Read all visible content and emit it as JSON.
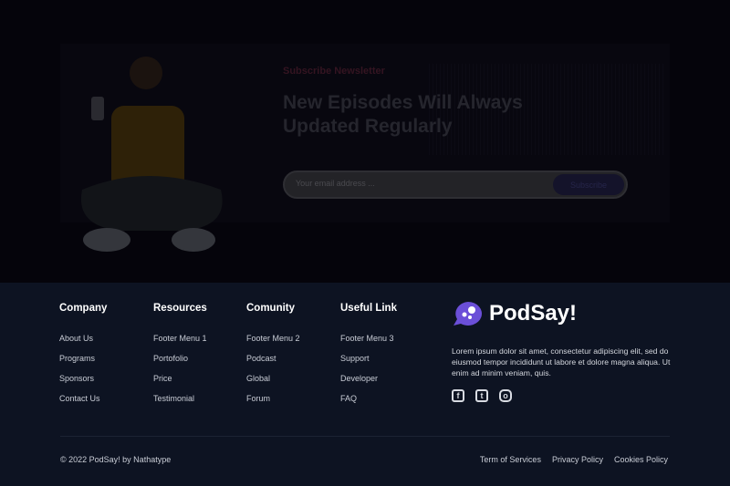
{
  "newsletter": {
    "label": "Subscribe Newsletter",
    "headline": "New Episodes Will Always Updated Regularly",
    "email_placeholder": "Your email address ...",
    "button": "Subscribe"
  },
  "footer": {
    "columns": [
      {
        "title": "Company",
        "links": [
          "About Us",
          "Programs",
          "Sponsors",
          "Contact Us"
        ]
      },
      {
        "title": "Resources",
        "links": [
          "Footer Menu 1",
          "Portofolio",
          "Price",
          "Testimonial"
        ]
      },
      {
        "title": "Comunity",
        "links": [
          "Footer Menu 2",
          "Podcast",
          "Global",
          "Forum"
        ]
      },
      {
        "title": "Useful Link",
        "links": [
          "Footer Menu 3",
          "Support",
          "Developer",
          "FAQ"
        ]
      }
    ],
    "brand": "PodSay!",
    "description": "Lorem ipsum dolor sit amet, consectetur adipiscing elit, sed do eiusmod tempor incididunt ut labore et dolore magna aliqua. Ut enim ad minim veniam, quis.",
    "social": [
      "facebook-icon",
      "twitter-icon",
      "instagram-icon"
    ],
    "copyright": "© 2022 PodSay! by Nathatype",
    "legal": [
      "Term of Services",
      "Privacy Policy",
      "Cookies Policy"
    ]
  },
  "colors": {
    "footer_bg": "#0d1322",
    "brand": "#6b4fd8"
  }
}
